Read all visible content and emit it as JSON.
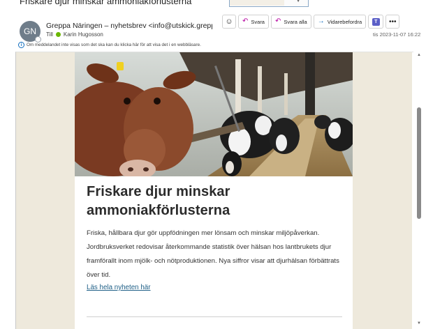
{
  "subject": "Friskare djur minskar ammoniakförlusterna",
  "message": {
    "avatar_initials": "GN",
    "sender": "Greppa Näringen – nyhetsbrev <info@utskick.greppa.r",
    "to_label": "Till",
    "recipient": "Karin Hugosson",
    "timestamp": "tis 2023-11-07 16:22"
  },
  "actions": {
    "reply": "Svara",
    "reply_all": "Svara alla",
    "forward": "Vidarebefordra"
  },
  "info_bar": "Om meddelandet inte visas som det ska kan du klicka här för att visa det i en webbläsare.",
  "article": {
    "title": "Friskare djur minskar ammoniakförlusterna",
    "body": "Friska, hållbara djur gör uppfödningen mer lönsam och minskar miljöpåverkan. Jordbruksverket redovisar återkommande statistik över hälsan hos lantbrukets djur framförallt inom mjölk- och nötproduktionen. Nya siffror visar att djurhälsan förbättrats över tid.",
    "link": "Läs hela nyheten här"
  },
  "icons": {
    "emoji": "emoji-icon",
    "reply": "reply-icon",
    "reply_all": "reply-all-icon",
    "forward": "forward-icon",
    "teams": "teams-icon",
    "more": "more-icon",
    "info": "info-icon"
  },
  "colors": {
    "accent": "#0f6cbd",
    "reply_icon": "#b4009e",
    "newsletter_background": "#eee9dc",
    "link": "#1d5e86",
    "presence": "#6bb700"
  }
}
